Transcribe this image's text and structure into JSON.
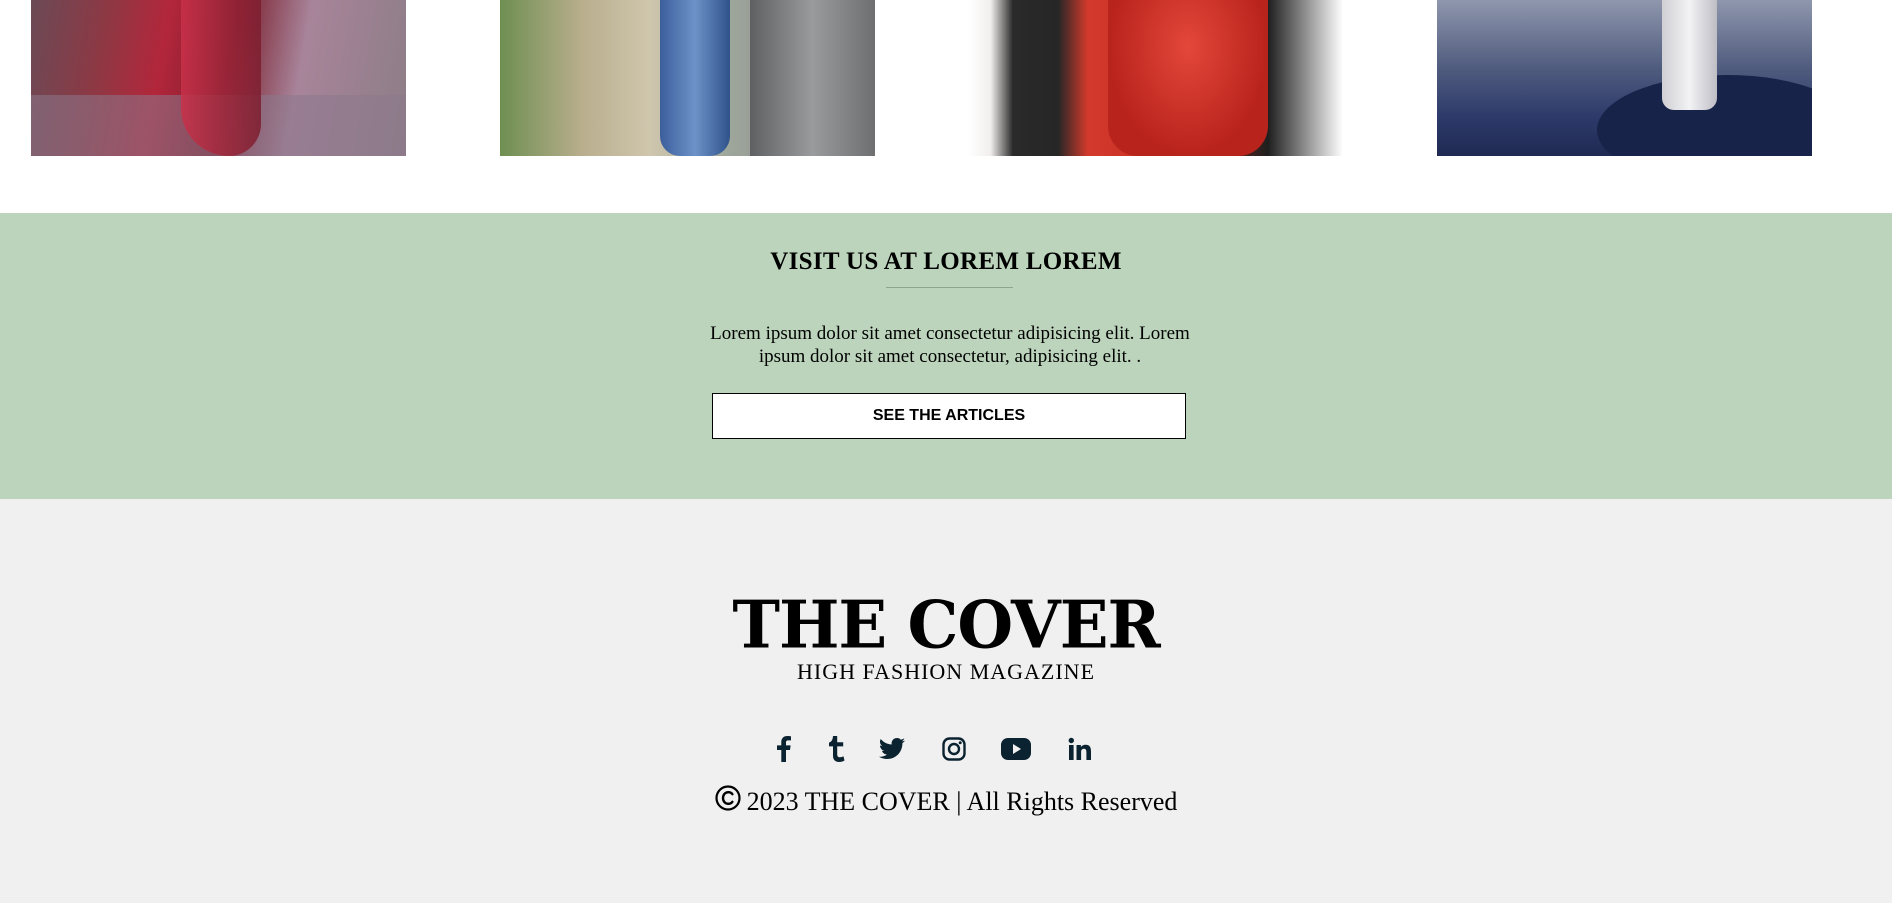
{
  "gallery": {
    "photos": [
      {
        "label": ""
      },
      {
        "label": ""
      },
      {
        "label": ""
      },
      {
        "label": ""
      }
    ]
  },
  "visit": {
    "title": "VISIT US AT LOREM LOREM",
    "text": "Lorem ipsum dolor sit amet consectetur adipisicing elit. Lorem ipsum dolor sit amet consectetur, adipisicing elit. .",
    "button_label": "SEE THE ARTICLES",
    "background_color": "#bbd4bb"
  },
  "footer": {
    "logo_title": "THE COVER",
    "logo_subtitle": "HIGH FASHION MAGAZINE",
    "social_icons": [
      "facebook-icon",
      "tumblr-icon",
      "twitter-icon",
      "instagram-icon",
      "youtube-icon",
      "linkedin-icon"
    ],
    "copyright_text": "2023 THE COVER | All Rights Reserved",
    "background_color": "#f0f0f0",
    "icon_color": "#0b2330"
  }
}
